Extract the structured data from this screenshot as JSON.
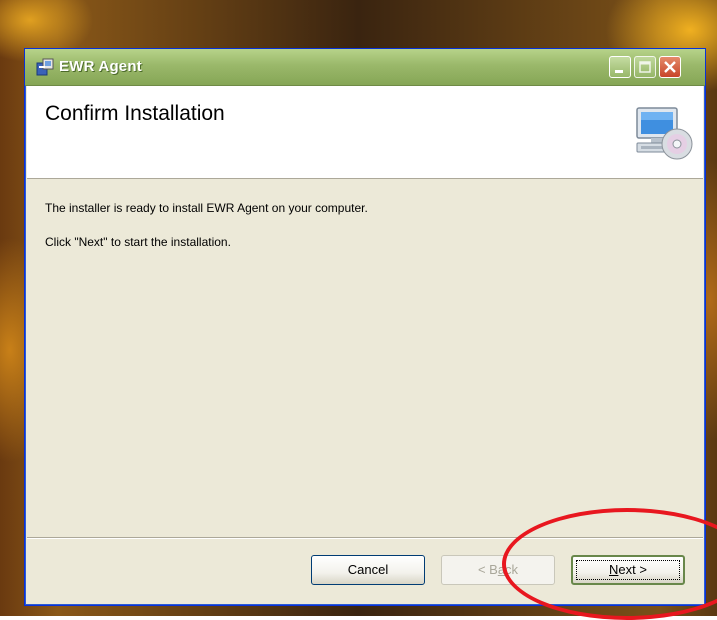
{
  "window": {
    "title": "EWR Agent",
    "controls": [
      "minimize",
      "maximize",
      "close"
    ]
  },
  "header": {
    "title": "Confirm Installation",
    "icon": "computer-cd-icon"
  },
  "body": {
    "line1": "The installer is ready to install EWR Agent on your computer.",
    "line2": "Click \"Next\" to start the installation."
  },
  "buttons": {
    "cancel": "Cancel",
    "back_prefix": "< B",
    "back_underlined": "a",
    "back_suffix": "ck",
    "back_enabled": false,
    "next_underlined": "N",
    "next_suffix": "ext >",
    "next_focused": true
  },
  "annotation": {
    "shape": "ellipse",
    "color": "#e8171f",
    "target": "next-button"
  },
  "colors": {
    "titlebar": "#9ab86a",
    "dialog_bg": "#ece9d8",
    "header_bg": "#ffffff",
    "close_button": "#c8452a"
  }
}
